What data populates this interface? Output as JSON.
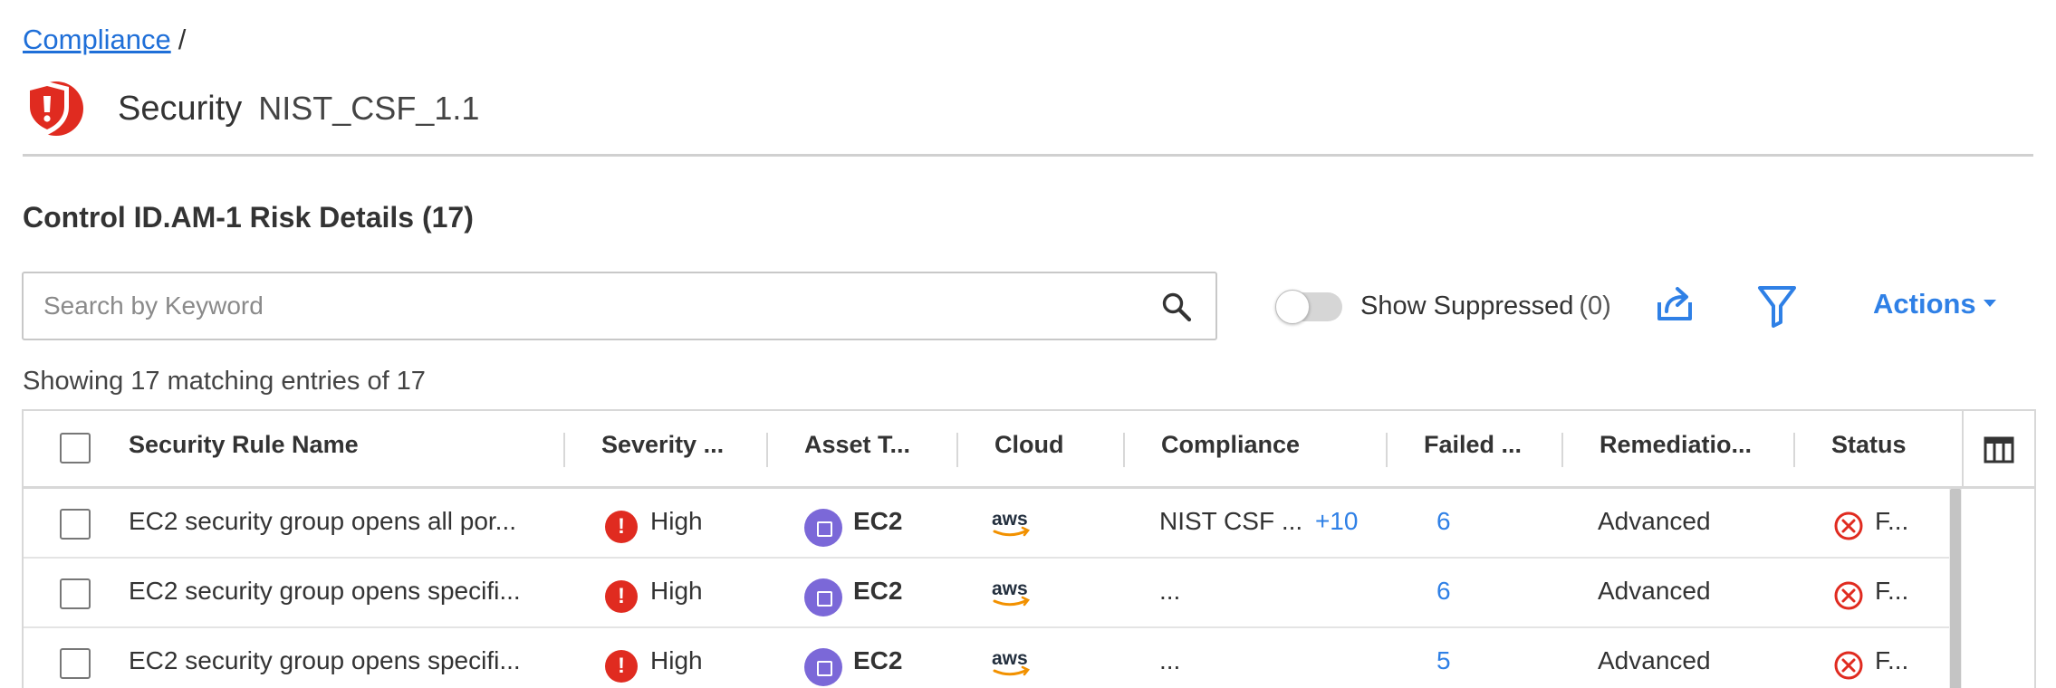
{
  "breadcrumb": {
    "link": "Compliance",
    "separator": "/"
  },
  "header": {
    "app_name": "Security",
    "framework": "NIST_CSF_1.1",
    "logo_icon": "shield-logo-icon",
    "brand_color": "#e02b20"
  },
  "section": {
    "title": "Control ID.AM-1 Risk Details (17)"
  },
  "search": {
    "placeholder": "Search by Keyword",
    "value": "",
    "icon": "search-icon"
  },
  "toolbar": {
    "show_suppressed_label": "Show Suppressed",
    "show_suppressed_count": "(0)",
    "show_suppressed_on": false,
    "export_icon": "share-icon",
    "filter_icon": "filter-icon",
    "actions_label": "Actions",
    "accent_color": "#2f80e6"
  },
  "entries_info": "Showing 17 matching entries of 17",
  "table": {
    "columns": [
      "Security Rule Name",
      "Severity ...",
      "Asset T...",
      "Cloud",
      "Compliance",
      "Failed ...",
      "Remediatio...",
      "Status"
    ],
    "rows": [
      {
        "rule": "EC2 security group opens all por...",
        "severity": "High",
        "asset": "EC2",
        "cloud": "aws",
        "compliance": "NIST CSF ...",
        "compliance_more": "+10",
        "failed": "6",
        "remediation": "Advanced",
        "status": "F..."
      },
      {
        "rule": "EC2 security group opens specifi...",
        "severity": "High",
        "asset": "EC2",
        "cloud": "aws",
        "compliance": "...",
        "compliance_more": "",
        "failed": "6",
        "remediation": "Advanced",
        "status": "F..."
      },
      {
        "rule": "EC2 security group opens specifi...",
        "severity": "High",
        "asset": "EC2",
        "cloud": "aws",
        "compliance": "...",
        "compliance_more": "",
        "failed": "5",
        "remediation": "Advanced",
        "status": "F..."
      }
    ]
  },
  "colors": {
    "severity_high": "#e02b20",
    "asset_ec2": "#7b68d8",
    "status_failed": "#e02b20"
  }
}
